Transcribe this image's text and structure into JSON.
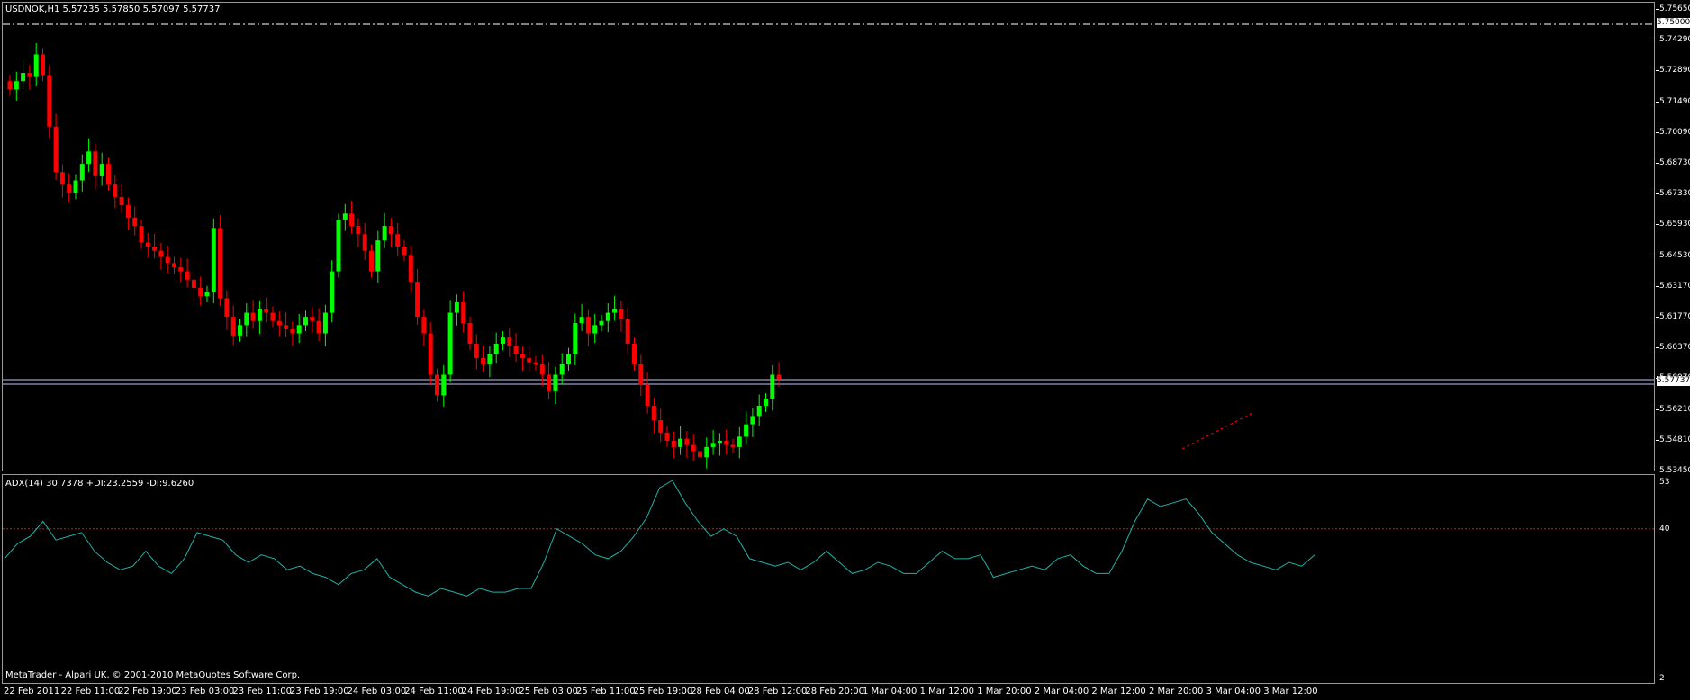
{
  "header": {
    "symbol_info": "USDNOK,H1  5.57235 5.57850 5.57097 5.57737"
  },
  "indicator": {
    "label": "ADX(14) 30.7378 +DI:23.2559 -DI:9.6260",
    "scale_top": "53",
    "scale_level": "40",
    "scale_bottom": "2"
  },
  "footer": {
    "copyright": "MetaTrader - Alpari UK, © 2001-2010 MetaQuotes Software Corp."
  },
  "price_axis": {
    "labels": [
      "5.75650",
      "5.74290",
      "5.72890",
      "5.71490",
      "5.70090",
      "5.68730",
      "5.67330",
      "5.65930",
      "5.64530",
      "5.63170",
      "5.61770",
      "5.60370",
      "5.58970",
      "5.56210",
      "5.54810",
      "5.53450"
    ],
    "alert_price": "5.75000",
    "current_price": "5.57737"
  },
  "time_axis": {
    "labels": [
      "22 Feb 2011",
      "22 Feb 11:00",
      "22 Feb 19:00",
      "23 Feb 03:00",
      "23 Feb 11:00",
      "23 Feb 19:00",
      "24 Feb 03:00",
      "24 Feb 11:00",
      "24 Feb 19:00",
      "25 Feb 03:00",
      "25 Feb 11:00",
      "25 Feb 19:00",
      "28 Feb 04:00",
      "28 Feb 12:00",
      "28 Feb 20:00",
      "1 Mar 04:00",
      "1 Mar 12:00",
      "1 Mar 20:00",
      "2 Mar 04:00",
      "2 Mar 12:00",
      "2 Mar 20:00",
      "3 Mar 04:00",
      "3 Mar 12:00"
    ]
  },
  "colors": {
    "bull": "#00ff00",
    "bear": "#ff0000",
    "adx_line": "#20b2aa",
    "level_line": "#ff0000",
    "grid_line": "#ffffff",
    "horizontal_line": "#c0c0ff"
  },
  "chart_data": {
    "type": "candlestick",
    "price_axis_range": [
      5.5345,
      5.7565
    ],
    "candles_close": [
      5.718,
      5.722,
      5.726,
      5.724,
      5.735,
      5.725,
      5.7,
      5.678,
      5.672,
      5.668,
      5.674,
      5.682,
      5.688,
      5.676,
      5.682,
      5.672,
      5.666,
      5.662,
      5.656,
      5.652,
      5.644,
      5.642,
      5.64,
      5.637,
      5.634,
      5.632,
      5.63,
      5.626,
      5.622,
      5.618,
      5.62,
      5.651,
      5.617,
      5.608,
      5.599,
      5.604,
      5.61,
      5.606,
      5.612,
      5.61,
      5.606,
      5.604,
      5.602,
      5.6,
      5.604,
      5.608,
      5.606,
      5.6,
      5.61,
      5.63,
      5.655,
      5.658,
      5.652,
      5.648,
      5.64,
      5.63,
      5.645,
      5.652,
      5.648,
      5.642,
      5.638,
      5.625,
      5.608,
      5.6,
      5.58,
      5.57,
      5.58,
      5.61,
      5.615,
      5.605,
      5.595,
      5.588,
      5.585,
      5.59,
      5.595,
      5.598,
      5.594,
      5.59,
      5.588,
      5.586,
      5.585,
      5.58,
      5.572,
      5.58,
      5.585,
      5.59,
      5.605,
      5.608,
      5.6,
      5.604,
      5.606,
      5.61,
      5.612,
      5.607,
      5.595,
      5.585,
      5.575,
      5.565,
      5.558,
      5.552,
      5.548,
      5.545,
      5.549,
      5.546,
      5.543,
      5.54,
      5.545,
      5.547,
      5.548,
      5.546,
      5.545,
      5.55,
      5.556,
      5.56,
      5.565,
      5.568,
      5.58,
      5.578
    ],
    "adx_values": [
      32,
      36,
      38,
      42,
      37,
      38,
      39,
      34,
      31,
      29,
      30,
      34,
      30,
      28,
      32,
      39,
      38,
      37,
      33,
      31,
      33,
      32,
      29,
      30,
      28,
      27,
      25,
      28,
      29,
      32,
      27,
      25,
      23,
      22,
      24,
      23,
      22,
      24,
      23,
      23,
      24,
      24,
      31,
      40,
      38,
      36,
      33,
      32,
      34,
      38,
      43,
      51,
      53,
      47,
      42,
      38,
      40,
      38,
      32,
      31,
      30,
      31,
      29,
      31,
      34,
      31,
      28,
      29,
      31,
      30,
      28,
      28,
      31,
      34,
      32,
      32,
      33,
      27,
      28,
      29,
      30,
      29,
      32,
      33,
      30,
      28,
      28,
      34,
      42,
      48,
      46,
      47,
      48,
      44,
      39,
      36,
      33,
      31,
      30,
      29,
      31,
      30,
      33
    ],
    "adx_range": [
      2,
      53
    ],
    "adx_level": 40
  }
}
